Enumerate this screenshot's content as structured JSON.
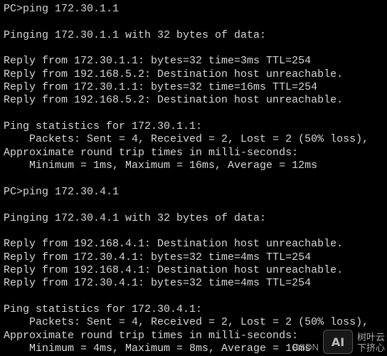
{
  "terminal": {
    "lines": [
      "PC>ping 172.30.1.1",
      "",
      "Pinging 172.30.1.1 with 32 bytes of data:",
      "",
      "Reply from 172.30.1.1: bytes=32 time=3ms TTL=254",
      "Reply from 192.168.5.2: Destination host unreachable.",
      "Reply from 172.30.1.1: bytes=32 time=16ms TTL=254",
      "Reply from 192.168.5.2: Destination host unreachable.",
      "",
      "Ping statistics for 172.30.1.1:",
      "    Packets: Sent = 4, Received = 2, Lost = 2 (50% loss),",
      "Approximate round trip times in milli-seconds:",
      "    Minimum = 1ms, Maximum = 16ms, Average = 12ms",
      "",
      "PC>ping 172.30.4.1",
      "",
      "Pinging 172.30.4.1 with 32 bytes of data:",
      "",
      "Reply from 192.168.4.1: Destination host unreachable.",
      "Reply from 172.30.4.1: bytes=32 time=4ms TTL=254",
      "Reply from 192.168.4.1: Destination host unreachable.",
      "Reply from 172.30.4.1: bytes=32 time=4ms TTL=254",
      "",
      "Ping statistics for 172.30.4.1:",
      "    Packets: Sent = 4, Received = 2, Lost = 2 (50% loss),",
      "Approximate round trip times in milli-seconds:",
      "    Minimum = 4ms, Maximum = 8ms, Average = 10ms"
    ]
  },
  "watermark": {
    "csdn": "CSDN",
    "badge": "AI",
    "line1": "树叶云",
    "line2": "下挤心"
  },
  "colors": {
    "background": "#000000",
    "text": "#d8d8d8"
  }
}
